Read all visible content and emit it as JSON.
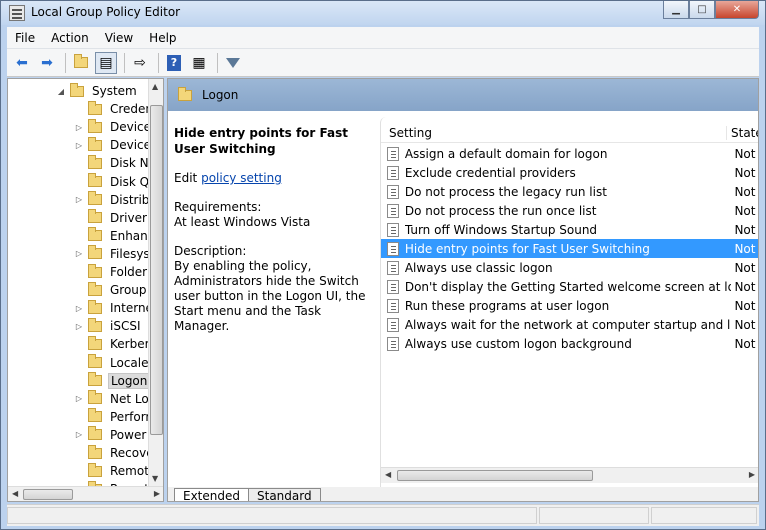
{
  "window": {
    "title": "Local Group Policy Editor"
  },
  "menu": [
    "File",
    "Action",
    "View",
    "Help"
  ],
  "tree": {
    "items": [
      {
        "label": "System",
        "expander": "open",
        "level": 0
      },
      {
        "label": "Credentials Delegation",
        "expander": "",
        "level": 1
      },
      {
        "label": "Device Installation",
        "expander": "closed",
        "level": 1
      },
      {
        "label": "Device Redirection",
        "expander": "closed",
        "level": 1
      },
      {
        "label": "Disk NV Cache",
        "expander": "",
        "level": 1
      },
      {
        "label": "Disk Quotas",
        "expander": "",
        "level": 1
      },
      {
        "label": "Distributed COM",
        "expander": "closed",
        "level": 1
      },
      {
        "label": "Driver Installation",
        "expander": "",
        "level": 1
      },
      {
        "label": "Enhanced Storage Access",
        "expander": "",
        "level": 1
      },
      {
        "label": "Filesystem",
        "expander": "closed",
        "level": 1
      },
      {
        "label": "Folder Redirection",
        "expander": "",
        "level": 1
      },
      {
        "label": "Group Policy",
        "expander": "",
        "level": 1
      },
      {
        "label": "Internet Communication Management",
        "expander": "closed",
        "level": 1
      },
      {
        "label": "iSCSI",
        "expander": "closed",
        "level": 1
      },
      {
        "label": "Kerberos",
        "expander": "",
        "level": 1
      },
      {
        "label": "Locale Services",
        "expander": "",
        "level": 1
      },
      {
        "label": "Logon",
        "expander": "",
        "level": 1,
        "selected": true
      },
      {
        "label": "Net Logon",
        "expander": "closed",
        "level": 1
      },
      {
        "label": "Performance Control Panel",
        "expander": "",
        "level": 1
      },
      {
        "label": "Power Management",
        "expander": "closed",
        "level": 1
      },
      {
        "label": "Recovery",
        "expander": "",
        "level": 1
      },
      {
        "label": "Remote Assistance",
        "expander": "",
        "level": 1
      },
      {
        "label": "Remote Procedure Call",
        "expander": "",
        "level": 1
      }
    ]
  },
  "header": {
    "folder": "Logon"
  },
  "description": {
    "title": "Hide entry points for Fast User Switching",
    "edit_prefix": "Edit",
    "edit_link": "policy setting",
    "requirements_label": "Requirements:",
    "requirements_value": "At least Windows Vista",
    "description_label": "Description:",
    "description_text": "By enabling the policy, Administrators hide the Switch user button in the Logon UI, the Start menu and the Task Manager."
  },
  "list": {
    "col_setting": "Setting",
    "col_state": "State",
    "rows": [
      {
        "name": "Assign a default domain for logon",
        "state": "Not configured"
      },
      {
        "name": "Exclude credential providers",
        "state": "Not configured"
      },
      {
        "name": "Do not process the legacy run list",
        "state": "Not configured"
      },
      {
        "name": "Do not process the run once list",
        "state": "Not configured"
      },
      {
        "name": "Turn off Windows Startup Sound",
        "state": "Not configured"
      },
      {
        "name": "Hide entry points for Fast User Switching",
        "state": "Not configured",
        "selected": true
      },
      {
        "name": "Always use classic logon",
        "state": "Not configured"
      },
      {
        "name": "Don't display the Getting Started welcome screen at logon",
        "state": "Not configured"
      },
      {
        "name": "Run these programs at user logon",
        "state": "Not configured"
      },
      {
        "name": "Always wait for the network at computer startup and logon",
        "state": "Not configured"
      },
      {
        "name": "Always use custom logon background",
        "state": "Not configured"
      }
    ]
  },
  "tabs": [
    "Extended",
    "Standard"
  ],
  "colors": {
    "selection": "#3399ff",
    "header": "#9cb7d6",
    "link": "#0645ad"
  }
}
